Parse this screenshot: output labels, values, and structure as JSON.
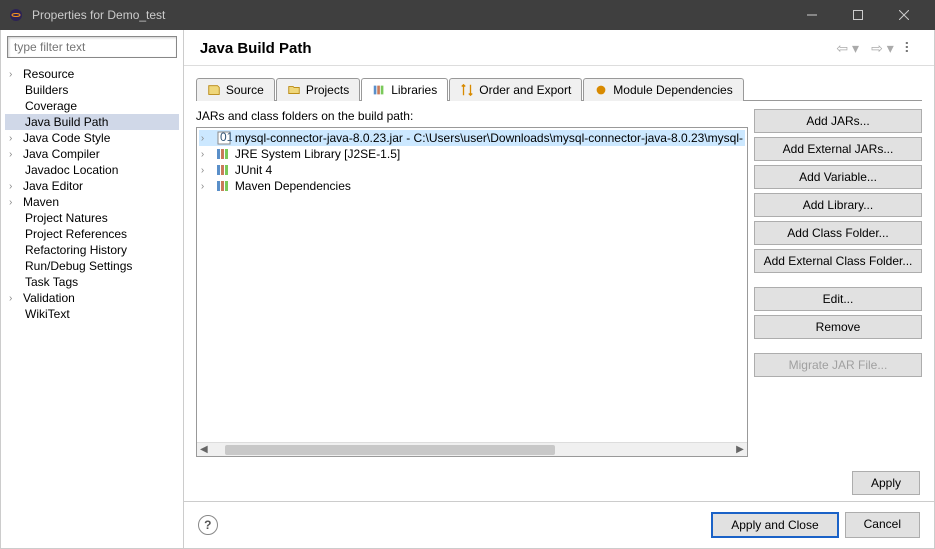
{
  "window": {
    "title": "Properties for Demo_test"
  },
  "sidebar": {
    "filter_placeholder": "type filter text",
    "items": [
      {
        "label": "Resource",
        "expandable": true
      },
      {
        "label": "Builders",
        "expandable": false
      },
      {
        "label": "Coverage",
        "expandable": false
      },
      {
        "label": "Java Build Path",
        "expandable": false,
        "selected": true
      },
      {
        "label": "Java Code Style",
        "expandable": true
      },
      {
        "label": "Java Compiler",
        "expandable": true
      },
      {
        "label": "Javadoc Location",
        "expandable": false
      },
      {
        "label": "Java Editor",
        "expandable": true
      },
      {
        "label": "Maven",
        "expandable": true
      },
      {
        "label": "Project Natures",
        "expandable": false
      },
      {
        "label": "Project References",
        "expandable": false
      },
      {
        "label": "Refactoring History",
        "expandable": false
      },
      {
        "label": "Run/Debug Settings",
        "expandable": false
      },
      {
        "label": "Task Tags",
        "expandable": false
      },
      {
        "label": "Validation",
        "expandable": true
      },
      {
        "label": "WikiText",
        "expandable": false
      }
    ]
  },
  "main": {
    "title": "Java Build Path",
    "tabs": [
      {
        "label": "Source",
        "icon": "source"
      },
      {
        "label": "Projects",
        "icon": "projects"
      },
      {
        "label": "Libraries",
        "icon": "libraries",
        "active": true
      },
      {
        "label": "Order and Export",
        "icon": "order"
      },
      {
        "label": "Module Dependencies",
        "icon": "module"
      }
    ],
    "jars_label": "JARs and class folders on the build path:",
    "jars": [
      {
        "label": "mysql-connector-java-8.0.23.jar - C:\\Users\\user\\Downloads\\mysql-connector-java-8.0.23\\mysql-",
        "type": "jar",
        "selected": true
      },
      {
        "label": "JRE System Library [J2SE-1.5]",
        "type": "lib"
      },
      {
        "label": "JUnit 4",
        "type": "lib"
      },
      {
        "label": "Maven Dependencies",
        "type": "lib"
      }
    ],
    "buttons": [
      {
        "label": "Add JARs...",
        "enabled": true
      },
      {
        "label": "Add External JARs...",
        "enabled": true
      },
      {
        "label": "Add Variable...",
        "enabled": true
      },
      {
        "label": "Add Library...",
        "enabled": true
      },
      {
        "label": "Add Class Folder...",
        "enabled": true
      },
      {
        "label": "Add External Class Folder...",
        "enabled": true
      },
      {
        "gap": true
      },
      {
        "label": "Edit...",
        "enabled": true
      },
      {
        "label": "Remove",
        "enabled": true
      },
      {
        "gap": true
      },
      {
        "label": "Migrate JAR File...",
        "enabled": false
      }
    ],
    "apply_label": "Apply"
  },
  "footer": {
    "apply_close": "Apply and Close",
    "cancel": "Cancel"
  }
}
